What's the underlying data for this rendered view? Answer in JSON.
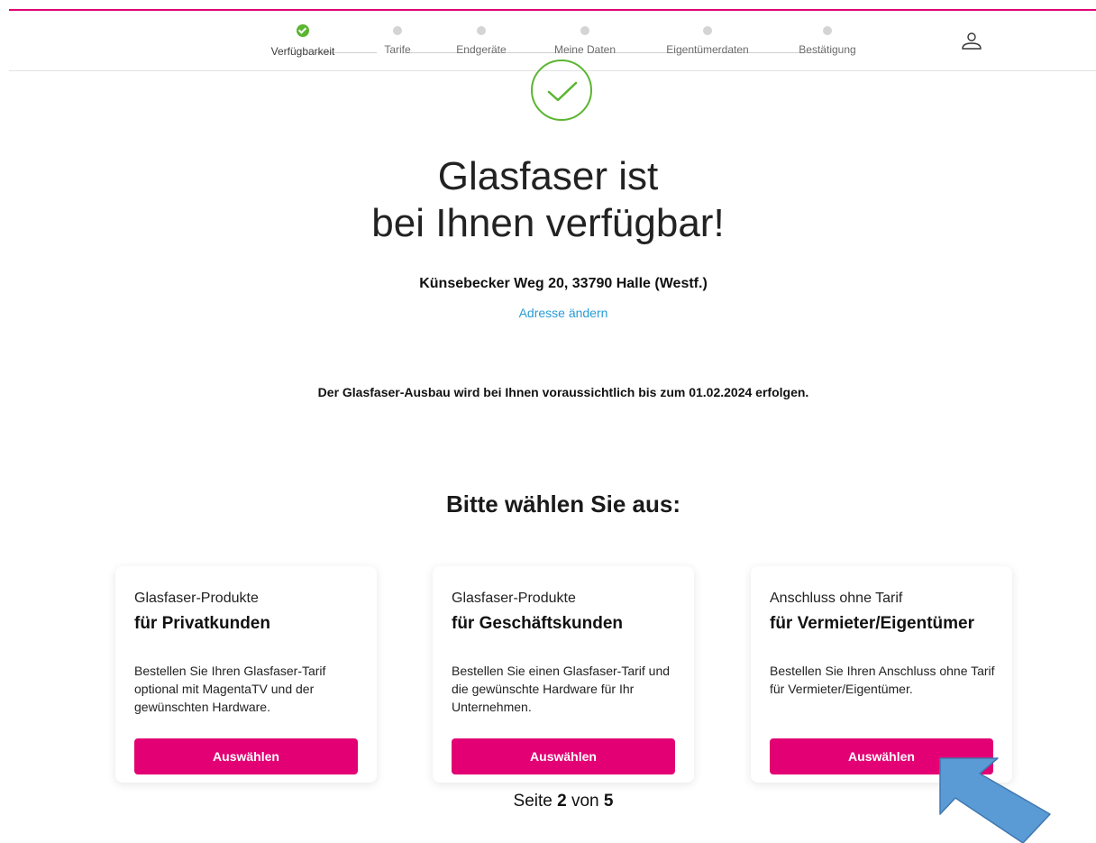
{
  "steps": [
    {
      "label": "Verfügbarkeit",
      "state": "done"
    },
    {
      "label": "Tarife",
      "state": "pending"
    },
    {
      "label": "Endgeräte",
      "state": "pending"
    },
    {
      "label": "Meine Daten",
      "state": "pending"
    },
    {
      "label": "Eigentümerdaten",
      "state": "pending"
    },
    {
      "label": "Bestätigung",
      "state": "pending"
    }
  ],
  "header": {
    "account_icon": "user-icon"
  },
  "hero": {
    "status_icon": "check-circle-icon",
    "headline_line1": "Glasfaser ist",
    "headline_line2": "bei Ihnen verfügbar!",
    "address": "Künsebecker Weg 20, 33790 Halle (Westf.)",
    "change_address_link": "Adresse ändern",
    "notice": "Der Glasfaser-Ausbau wird bei Ihnen voraussichtlich bis zum 01.02.2024 erfolgen."
  },
  "selection": {
    "title": "Bitte wählen Sie aus:",
    "cards": [
      {
        "kicker": "Glasfaser-Produkte",
        "title": "für Privatkunden",
        "desc": "Bestellen Sie Ihren Glasfaser-Tarif optional mit MagentaTV und der gewünschten Hardware.",
        "button": "Auswählen"
      },
      {
        "kicker": "Glasfaser-Produkte",
        "title": "für Geschäftskunden",
        "desc": "Bestellen Sie einen Glasfaser-Tarif und die gewünschte Hardware für Ihr Unternehmen.",
        "button": "Auswählen"
      },
      {
        "kicker": "Anschluss ohne Tarif",
        "title": "für Vermieter/Eigentümer",
        "desc": "Bestellen Sie Ihren Anschluss ohne Tarif für Vermieter/Eigentümer.",
        "button": "Auswählen"
      }
    ]
  },
  "footer": {
    "prefix": "Seite ",
    "current": "2",
    "middle": " von ",
    "total": "5"
  },
  "annotation": {
    "icon": "pointer-arrow-icon",
    "color": "#5b9bd5"
  },
  "colors": {
    "brand": "#e20074",
    "success": "#5bb531",
    "link": "#2a9bd4"
  }
}
